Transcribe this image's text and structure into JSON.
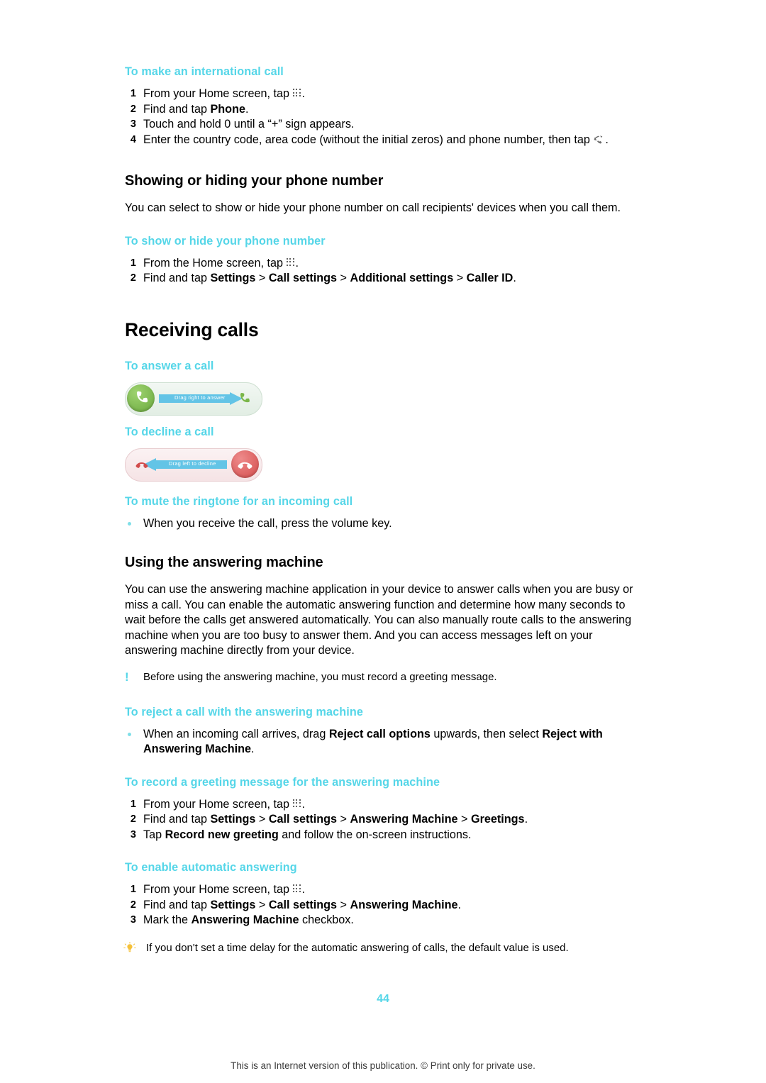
{
  "page": {
    "number": "44",
    "footer": "This is an Internet version of this publication. © Print only for private use."
  },
  "blocks": {
    "intl_call": {
      "heading": "To make an international call",
      "steps": [
        {
          "num": "1",
          "pre": "From your Home screen, tap ",
          "icon": "grid-icon",
          "post": "."
        },
        {
          "num": "2",
          "pre": "Find and tap ",
          "bold": "Phone",
          "post": "."
        },
        {
          "num": "3",
          "pre": "Touch and hold 0 until a “+” sign appears.",
          "post": ""
        },
        {
          "num": "4",
          "pre": "Enter the country code, area code (without the initial zeros) and phone number, then tap ",
          "icon": "call-icon",
          "post": "."
        }
      ]
    },
    "showing_hiding": {
      "heading": "Showing or hiding your phone number",
      "body": "You can select to show or hide your phone number on call recipients' devices when you call them.",
      "task": "To show or hide your phone number",
      "steps": [
        {
          "num": "1",
          "pre": "From the Home screen, tap ",
          "icon": "grid-icon",
          "post": "."
        },
        {
          "num": "2",
          "pre": "Find and tap ",
          "bold": "Settings",
          "mid": " > ",
          "bold2": "Call settings",
          "mid2": " > ",
          "bold3": "Additional settings",
          "mid3": " > ",
          "bold4": "Caller ID",
          "post": "."
        }
      ]
    },
    "receiving": {
      "heading": "Receiving calls",
      "answer_task": "To answer a call",
      "answer_slider_label": "Drag right to answer",
      "decline_task": "To decline a call",
      "decline_slider_label": "Drag left to decline",
      "mute_task": "To mute the ringtone for an incoming call",
      "mute_bullet": "When you receive the call, press the volume key."
    },
    "answering_machine": {
      "heading": "Using the answering machine",
      "body": "You can use the answering machine application in your device to answer calls when you are busy or miss a call. You can enable the automatic answering function and determine how many seconds to wait before the calls get answered automatically. You can also manually route calls to the answering machine when you are too busy to answer them. And you can access messages left on your answering machine directly from your device.",
      "note": "Before using the answering machine, you must record a greeting message.",
      "reject_task": "To reject a call with the answering machine",
      "reject_bullet_pre": "When an incoming call arrives, drag ",
      "reject_bullet_bold": "Reject call options",
      "reject_bullet_mid": " upwards, then select ",
      "reject_bullet_bold2": "Reject with Answering Machine",
      "reject_bullet_post": ".",
      "record_task": "To record a greeting message for the answering machine",
      "record_steps": [
        {
          "num": "1",
          "pre": "From your Home screen, tap ",
          "icon": "grid-icon",
          "post": "."
        },
        {
          "num": "2",
          "pre": "Find and tap ",
          "bold": "Settings",
          "mid": " > ",
          "bold2": "Call settings",
          "mid2": " > ",
          "bold3": "Answering Machine",
          "mid3": " > ",
          "bold4": "Greetings",
          "post": "."
        },
        {
          "num": "3",
          "pre": "Tap ",
          "bold": "Record new greeting",
          "post": " and follow the on-screen instructions."
        }
      ],
      "enable_task": "To enable automatic answering",
      "enable_steps": [
        {
          "num": "1",
          "pre": "From your Home screen, tap ",
          "icon": "grid-icon",
          "post": "."
        },
        {
          "num": "2",
          "pre": "Find and tap ",
          "bold": "Settings",
          "mid": " > ",
          "bold2": "Call settings",
          "mid2": " > ",
          "bold3": "Answering Machine",
          "post": "."
        },
        {
          "num": "3",
          "pre": "Mark the ",
          "bold": "Answering Machine",
          "post": " checkbox."
        }
      ],
      "tip": "If you don't set a time delay for the automatic answering of calls, the default value is used."
    }
  },
  "colors": {
    "accent": "#55d6e8",
    "text": "#000000"
  }
}
